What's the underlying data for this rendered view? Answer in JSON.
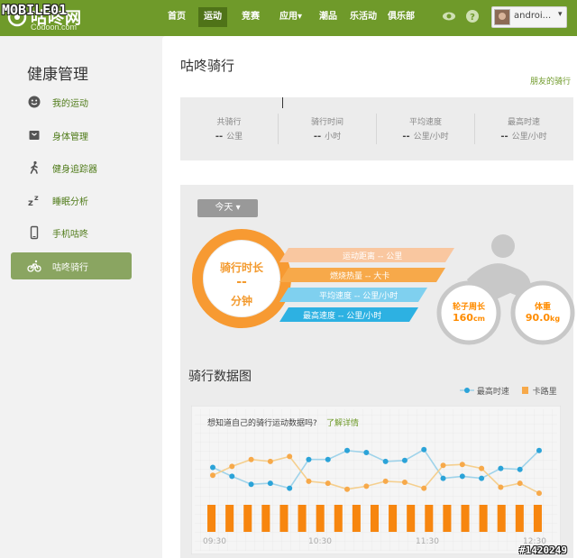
{
  "watermark": "MOBILE01",
  "watermark_id": "#1420249",
  "logo": {
    "brand": "咕咚网",
    "domain": "Codoon.com"
  },
  "nav": [
    {
      "label": "首页",
      "active": false
    },
    {
      "label": "运动",
      "active": true
    },
    {
      "label": "竞赛",
      "active": false
    },
    {
      "label": "应用▾",
      "active": false
    },
    {
      "label": "潮品",
      "active": false
    },
    {
      "label": "乐活动",
      "active": false
    },
    {
      "label": "俱乐部",
      "active": false
    }
  ],
  "user": {
    "name": "androi...",
    "caret": "▾"
  },
  "sidebar": {
    "title": "健康管理",
    "items": [
      {
        "label": "我的运动",
        "icon": "smile-icon",
        "active": false
      },
      {
        "label": "身体管理",
        "icon": "scale-icon",
        "active": false
      },
      {
        "label": "健身追踪器",
        "icon": "walker-icon",
        "active": false
      },
      {
        "label": "睡眠分析",
        "icon": "sleep-icon",
        "active": false
      },
      {
        "label": "手机咕咚",
        "icon": "phone-icon",
        "active": false
      },
      {
        "label": "咕咚骑行",
        "icon": "bike-icon",
        "active": true
      }
    ]
  },
  "main": {
    "title": "咕咚骑行",
    "friends_link": "朋友的骑行",
    "summary": [
      {
        "label": "共骑行",
        "value": "--",
        "unit": "公里"
      },
      {
        "label": "骑行时间",
        "value": "--",
        "unit": "小时"
      },
      {
        "label": "平均速度",
        "value": "--",
        "unit": "公里/小时"
      },
      {
        "label": "最高时速",
        "value": "--",
        "unit": "公里/小时"
      }
    ],
    "day_button": "今天 ▾",
    "ring": {
      "title": "骑行时长",
      "value": "--",
      "unit": "分钟"
    },
    "bars": [
      {
        "label": "运动距离",
        "value": "--",
        "unit": "公里",
        "color": "#f9c7a0"
      },
      {
        "label": "燃烧热量",
        "value": "--",
        "unit": "大卡",
        "color": "#f7a94a"
      },
      {
        "label": "平均速度",
        "value": "--",
        "unit": "公里/小时",
        "color": "#7fd0ef"
      },
      {
        "label": "最高速度",
        "value": "--",
        "unit": "公里/小时",
        "color": "#2db1e2"
      }
    ],
    "wheel_left": {
      "label": "轮子周长",
      "value": "160",
      "unit": "cm"
    },
    "wheel_right": {
      "label": "体重",
      "value": "90.0",
      "unit": "kg"
    },
    "chart_title": "骑行数据图",
    "legend": {
      "speed": "最高时速",
      "calorie": "卡路里"
    },
    "chart_prompt": "想知道自己的骑行运动数据吗?",
    "chart_link": "了解详情",
    "colors": {
      "accent": "#6f9a2a",
      "speed": "#2ba3d8",
      "speed_line": "#9fd3ea",
      "calorie": "#f7a94a",
      "bar": "#f7860f"
    }
  },
  "chart_data": {
    "type": "bar",
    "categories": [
      "09:30",
      "10:30",
      "11:30",
      "12:30"
    ],
    "bars": [
      5,
      5,
      5,
      5,
      5,
      5,
      5,
      5,
      5,
      5,
      5,
      5,
      5,
      5,
      5,
      5,
      5,
      5,
      5,
      5,
      5,
      5,
      5,
      5,
      5,
      5,
      5,
      5,
      5,
      5,
      5,
      5,
      5,
      5,
      5,
      5,
      5,
      5,
      5
    ],
    "series": [
      {
        "name": "最高时速",
        "values": [
          6.5,
          5.6,
          4.8,
          4.9,
          4.4,
          7.3,
          7.3,
          8.2,
          8.0,
          7.1,
          7.2,
          8.3,
          5.4,
          5.6,
          5.4,
          6.4,
          6.3,
          8.2
        ]
      },
      {
        "name": "卡路里",
        "values": [
          5.7,
          6.6,
          7.3,
          7.1,
          7.6,
          5.1,
          4.9,
          4.3,
          4.6,
          5.1,
          5.0,
          4.4,
          6.7,
          6.8,
          6.4,
          4.5,
          4.9,
          3.9
        ]
      }
    ],
    "xlabels": [
      "09:30",
      "10:30",
      "11:30",
      "12:30"
    ],
    "ylim": [
      0,
      10
    ]
  }
}
